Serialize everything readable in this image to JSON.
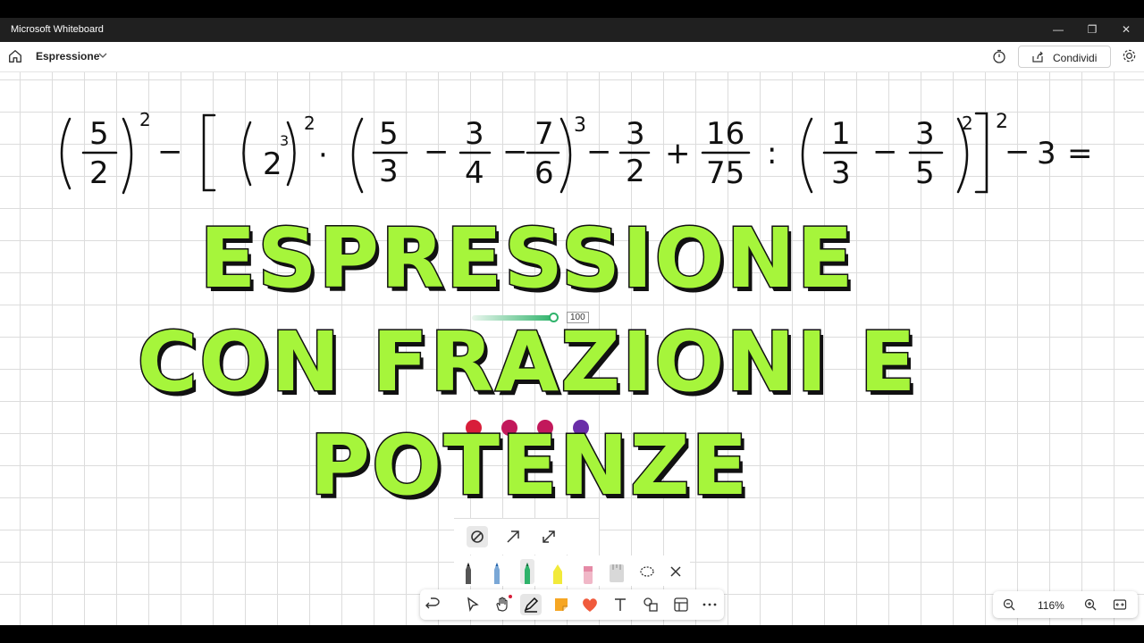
{
  "window": {
    "title": "Microsoft Whiteboard",
    "controls": {
      "minimize": "—",
      "restore": "❐",
      "close": "✕"
    }
  },
  "toolbar": {
    "board_name": "Espressione",
    "share_label": "Condividi"
  },
  "expression": {
    "term1": {
      "num": "5",
      "den": "2",
      "exp": "2"
    },
    "op1": "−",
    "bracket_open": "[",
    "power_base": "2",
    "power_inner_exp": "3",
    "power_outer_exp": "2",
    "dot": "·",
    "f1": {
      "num": "5",
      "den": "3"
    },
    "op2": "−",
    "f2": {
      "num": "3",
      "den": "4"
    },
    "op3": "−",
    "f3": {
      "num": "7",
      "den": "6"
    },
    "group1_exp": "3",
    "op4": "−",
    "f4": {
      "num": "3",
      "den": "2"
    },
    "op5": "+",
    "f5": {
      "num": "16",
      "den": "75"
    },
    "colon": ":",
    "f6": {
      "num": "1",
      "den": "3"
    },
    "op6": "−",
    "f7": {
      "num": "3",
      "den": "5"
    },
    "group2_exp": "2",
    "bracket_close": "]",
    "bracket_exp": "2",
    "op7": "−",
    "last": "3",
    "eq": "="
  },
  "overlay_title": {
    "line1": "ESPRESSIONE",
    "line2": "CON FRAZIONI E",
    "line3": "POTENZE"
  },
  "pen_settings": {
    "thickness_value": "100",
    "swatch_colors": [
      "#d81e3a",
      "#c2185b",
      "#c2185b",
      "#6a2ea8"
    ]
  },
  "zoom": {
    "level": "116%"
  },
  "colors": {
    "title_fill": "#a6f53b",
    "accent_green": "#2fb36b"
  }
}
